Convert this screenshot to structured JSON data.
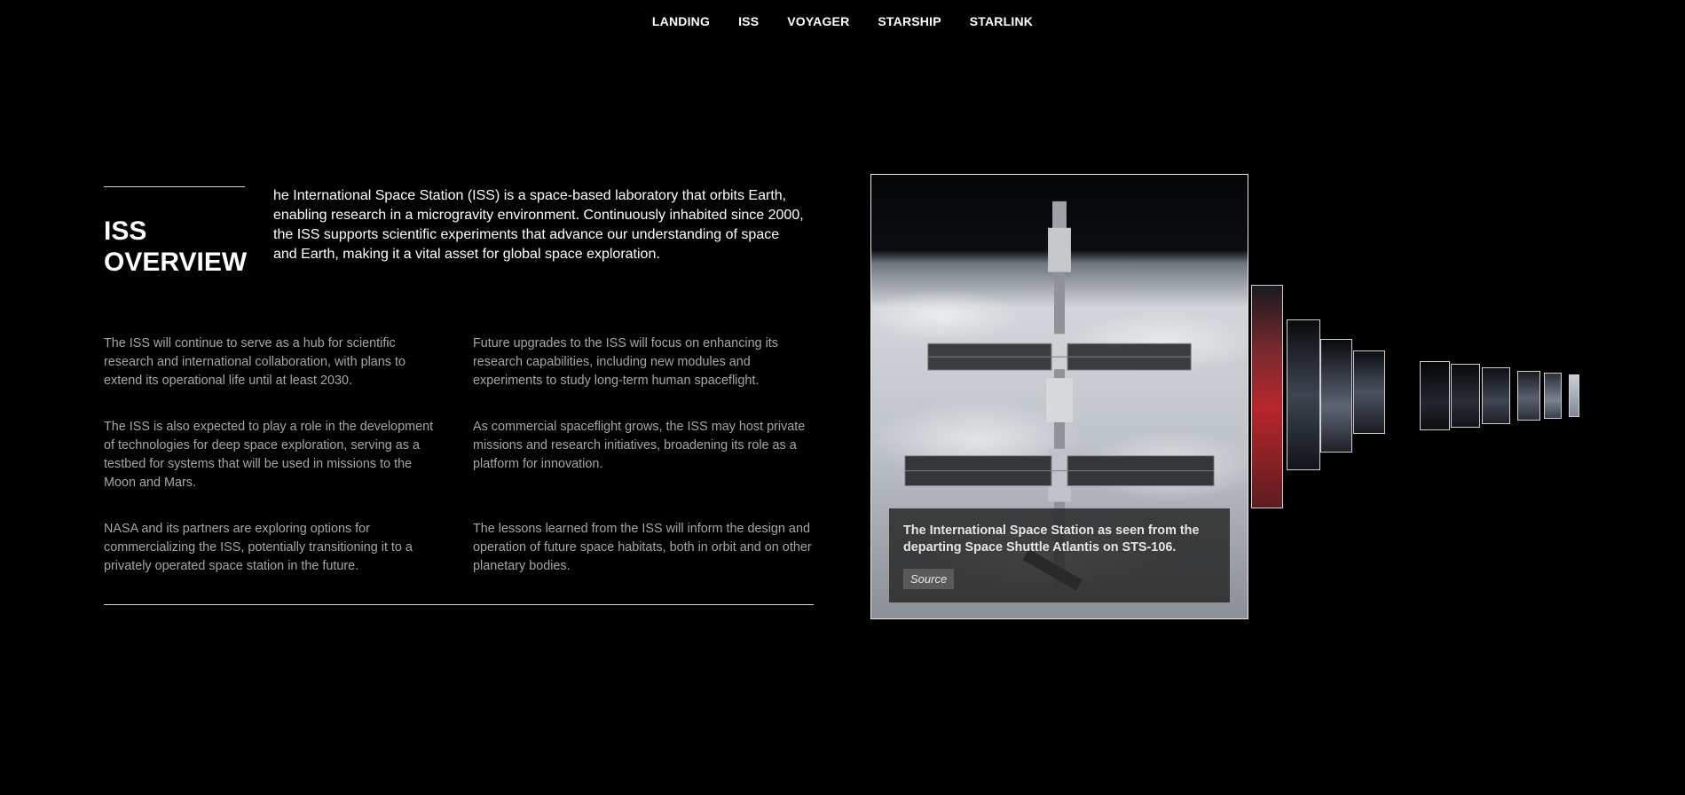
{
  "nav": {
    "items": [
      "LANDING",
      "ISS",
      "VOYAGER",
      "STARSHIP",
      "STARLINK"
    ]
  },
  "overview": {
    "title": "ISS OVERVIEW",
    "intro": "he International Space Station (ISS) is a space-based laboratory that orbits Earth, enabling research in a microgravity environment. Continuously inhabited since 2000, the ISS supports scientific experiments that advance our understanding of space and Earth, making it a vital asset for global space exploration."
  },
  "paragraphs": {
    "p1": "The ISS will continue to serve as a hub for scientific research and international collaboration, with plans to extend its operational life until at least 2030.",
    "p2": "Future upgrades to the ISS will focus on enhancing its research capabilities, including new modules and experiments to study long-term human spaceflight.",
    "p3": "The ISS is also expected to play a role in the development of technologies for deep space exploration, serving as a testbed for systems that will be used in missions to the Moon and Mars.",
    "p4": "As commercial spaceflight grows, the ISS may host private missions and research initiatives, broadening its role as a platform for innovation.",
    "p5": "NASA and its partners are exploring options for commercializing the ISS, potentially transitioning it to a privately operated space station in the future.",
    "p6": "The lessons learned from the ISS will inform the design and operation of future space habitats, both in orbit and on other planetary bodies."
  },
  "gallery": {
    "caption": "The International Space Station as seen from the departing Space Shuttle Atlantis on STS-106.",
    "source_label": "Source"
  },
  "colors": {
    "background": "#000000",
    "text_primary": "#ffffff",
    "text_secondary": "#a6a6a6",
    "caption_bg": "#282828"
  }
}
